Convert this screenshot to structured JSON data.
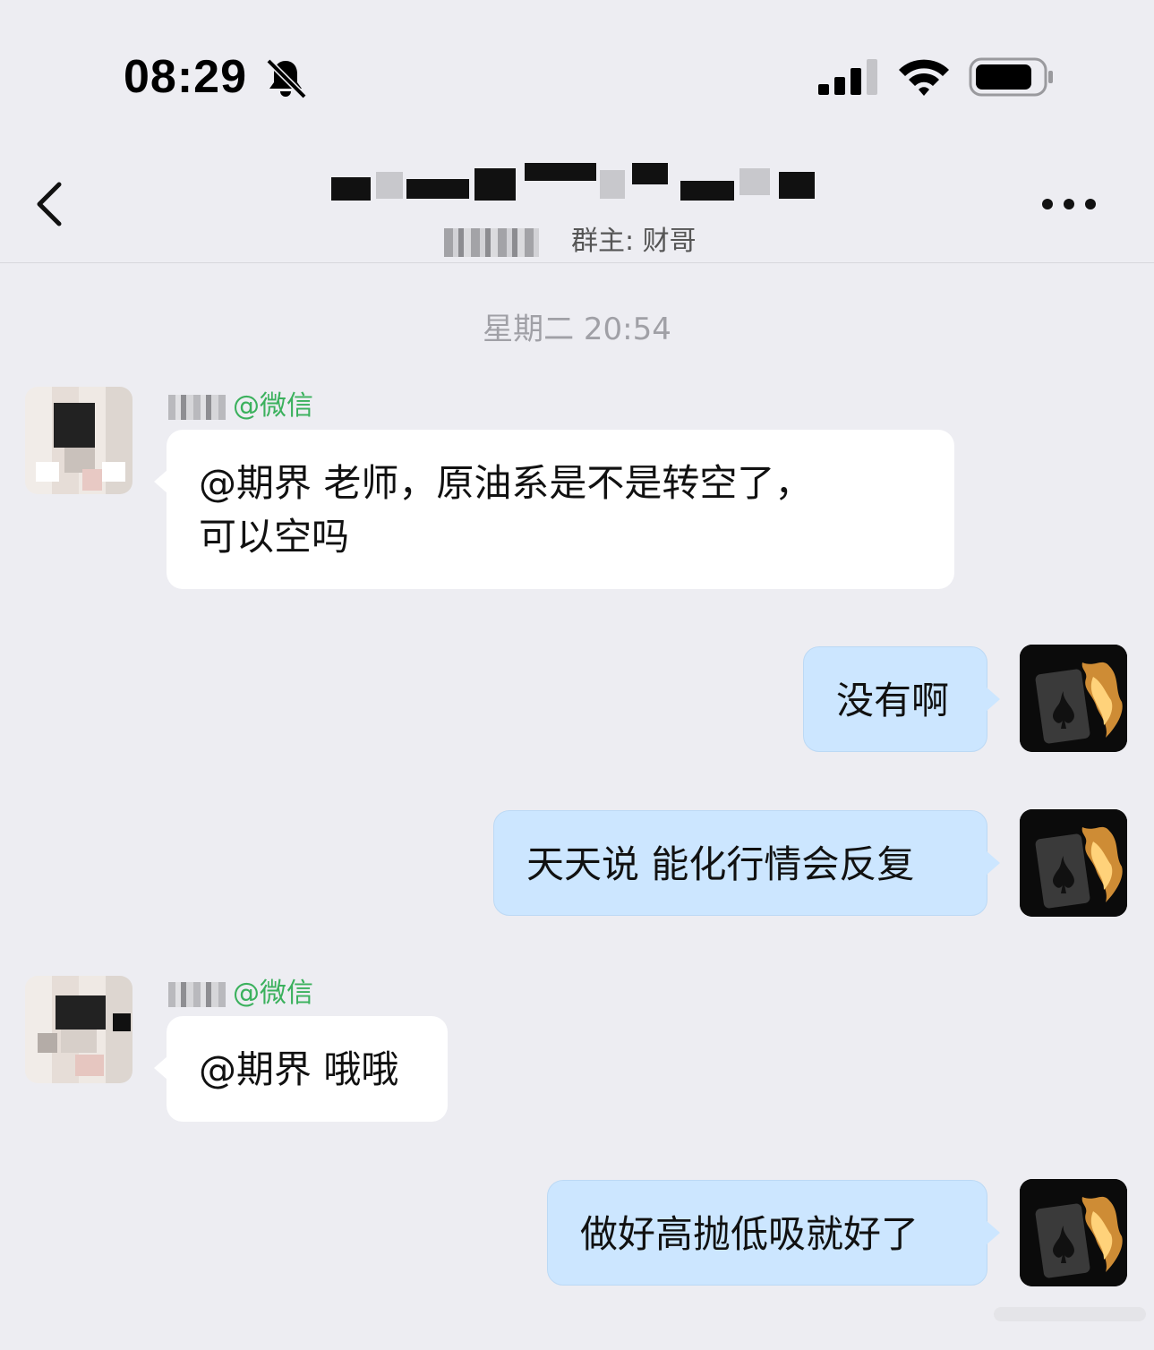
{
  "status_bar": {
    "time": "08:29",
    "icons": [
      "bell-muted-icon",
      "signal-icon",
      "wifi-icon",
      "battery-icon"
    ]
  },
  "header": {
    "subtitle_owner": "群主: 财哥",
    "icons": [
      "back-chevron-icon",
      "more-icon"
    ]
  },
  "chat": {
    "time_divider": "星期二 20:54",
    "messages": [
      {
        "side": "left",
        "sender_tag": "@微信",
        "lines": [
          "@期界 老师，原油系是不是转空了，",
          "可以空吗"
        ]
      },
      {
        "side": "right",
        "lines": [
          "没有啊"
        ]
      },
      {
        "side": "right",
        "lines": [
          "天天说 能化行情会反复"
        ]
      },
      {
        "side": "left",
        "sender_tag": "@微信",
        "lines": [
          "@期界 哦哦"
        ]
      },
      {
        "side": "right",
        "lines": [
          "做好高抛低吸就好了"
        ]
      }
    ]
  },
  "colors": {
    "background": "#ededf2",
    "bubble_incoming": "#ffffff",
    "bubble_outgoing": "#cce6ff",
    "wechat_tag": "#3bb15d"
  }
}
